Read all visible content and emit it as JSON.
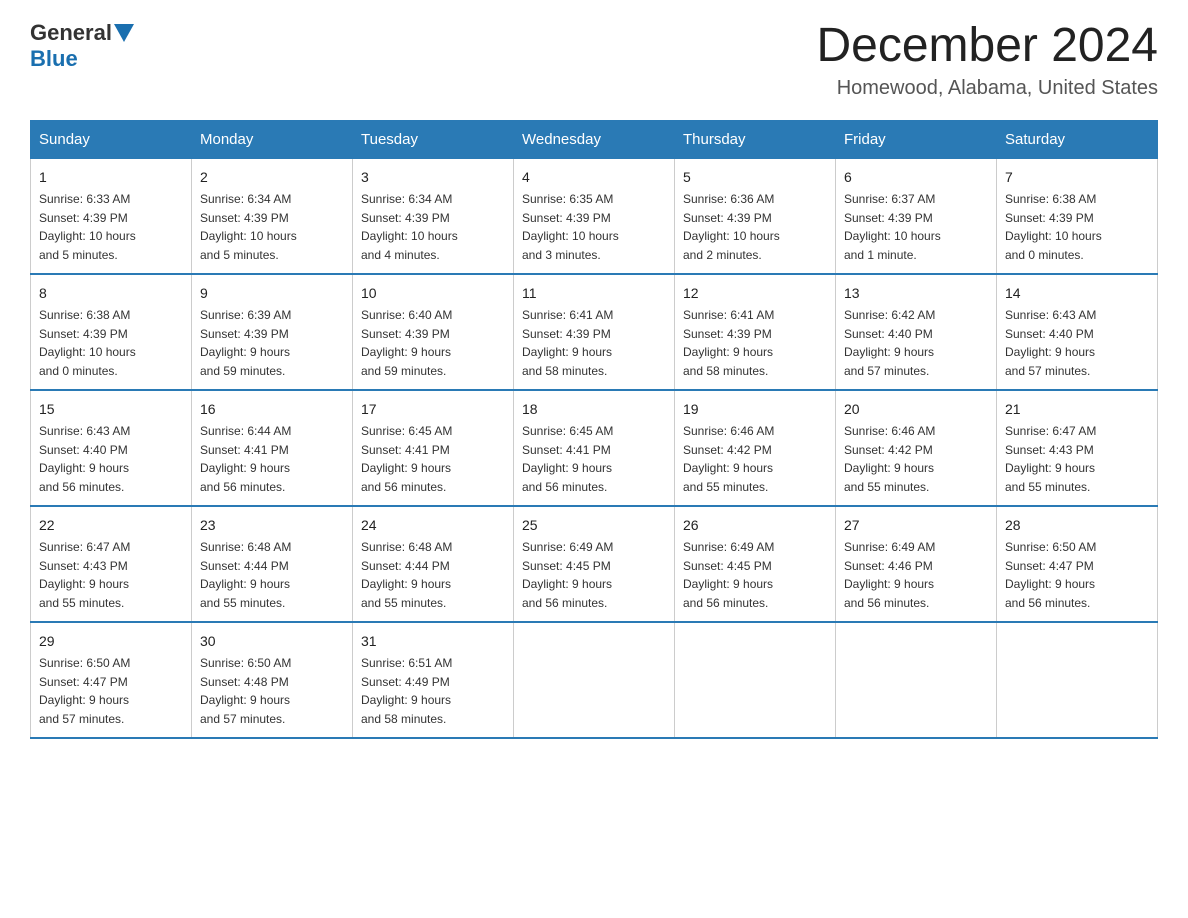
{
  "header": {
    "logo_general": "General",
    "logo_blue": "Blue",
    "month_title": "December 2024",
    "location": "Homewood, Alabama, United States"
  },
  "days_of_week": [
    "Sunday",
    "Monday",
    "Tuesday",
    "Wednesday",
    "Thursday",
    "Friday",
    "Saturday"
  ],
  "weeks": [
    [
      {
        "day": "1",
        "sunrise": "6:33 AM",
        "sunset": "4:39 PM",
        "daylight": "10 hours and 5 minutes."
      },
      {
        "day": "2",
        "sunrise": "6:34 AM",
        "sunset": "4:39 PM",
        "daylight": "10 hours and 5 minutes."
      },
      {
        "day": "3",
        "sunrise": "6:34 AM",
        "sunset": "4:39 PM",
        "daylight": "10 hours and 4 minutes."
      },
      {
        "day": "4",
        "sunrise": "6:35 AM",
        "sunset": "4:39 PM",
        "daylight": "10 hours and 3 minutes."
      },
      {
        "day": "5",
        "sunrise": "6:36 AM",
        "sunset": "4:39 PM",
        "daylight": "10 hours and 2 minutes."
      },
      {
        "day": "6",
        "sunrise": "6:37 AM",
        "sunset": "4:39 PM",
        "daylight": "10 hours and 1 minute."
      },
      {
        "day": "7",
        "sunrise": "6:38 AM",
        "sunset": "4:39 PM",
        "daylight": "10 hours and 0 minutes."
      }
    ],
    [
      {
        "day": "8",
        "sunrise": "6:38 AM",
        "sunset": "4:39 PM",
        "daylight": "10 hours and 0 minutes."
      },
      {
        "day": "9",
        "sunrise": "6:39 AM",
        "sunset": "4:39 PM",
        "daylight": "9 hours and 59 minutes."
      },
      {
        "day": "10",
        "sunrise": "6:40 AM",
        "sunset": "4:39 PM",
        "daylight": "9 hours and 59 minutes."
      },
      {
        "day": "11",
        "sunrise": "6:41 AM",
        "sunset": "4:39 PM",
        "daylight": "9 hours and 58 minutes."
      },
      {
        "day": "12",
        "sunrise": "6:41 AM",
        "sunset": "4:39 PM",
        "daylight": "9 hours and 58 minutes."
      },
      {
        "day": "13",
        "sunrise": "6:42 AM",
        "sunset": "4:40 PM",
        "daylight": "9 hours and 57 minutes."
      },
      {
        "day": "14",
        "sunrise": "6:43 AM",
        "sunset": "4:40 PM",
        "daylight": "9 hours and 57 minutes."
      }
    ],
    [
      {
        "day": "15",
        "sunrise": "6:43 AM",
        "sunset": "4:40 PM",
        "daylight": "9 hours and 56 minutes."
      },
      {
        "day": "16",
        "sunrise": "6:44 AM",
        "sunset": "4:41 PM",
        "daylight": "9 hours and 56 minutes."
      },
      {
        "day": "17",
        "sunrise": "6:45 AM",
        "sunset": "4:41 PM",
        "daylight": "9 hours and 56 minutes."
      },
      {
        "day": "18",
        "sunrise": "6:45 AM",
        "sunset": "4:41 PM",
        "daylight": "9 hours and 56 minutes."
      },
      {
        "day": "19",
        "sunrise": "6:46 AM",
        "sunset": "4:42 PM",
        "daylight": "9 hours and 55 minutes."
      },
      {
        "day": "20",
        "sunrise": "6:46 AM",
        "sunset": "4:42 PM",
        "daylight": "9 hours and 55 minutes."
      },
      {
        "day": "21",
        "sunrise": "6:47 AM",
        "sunset": "4:43 PM",
        "daylight": "9 hours and 55 minutes."
      }
    ],
    [
      {
        "day": "22",
        "sunrise": "6:47 AM",
        "sunset": "4:43 PM",
        "daylight": "9 hours and 55 minutes."
      },
      {
        "day": "23",
        "sunrise": "6:48 AM",
        "sunset": "4:44 PM",
        "daylight": "9 hours and 55 minutes."
      },
      {
        "day": "24",
        "sunrise": "6:48 AM",
        "sunset": "4:44 PM",
        "daylight": "9 hours and 55 minutes."
      },
      {
        "day": "25",
        "sunrise": "6:49 AM",
        "sunset": "4:45 PM",
        "daylight": "9 hours and 56 minutes."
      },
      {
        "day": "26",
        "sunrise": "6:49 AM",
        "sunset": "4:45 PM",
        "daylight": "9 hours and 56 minutes."
      },
      {
        "day": "27",
        "sunrise": "6:49 AM",
        "sunset": "4:46 PM",
        "daylight": "9 hours and 56 minutes."
      },
      {
        "day": "28",
        "sunrise": "6:50 AM",
        "sunset": "4:47 PM",
        "daylight": "9 hours and 56 minutes."
      }
    ],
    [
      {
        "day": "29",
        "sunrise": "6:50 AM",
        "sunset": "4:47 PM",
        "daylight": "9 hours and 57 minutes."
      },
      {
        "day": "30",
        "sunrise": "6:50 AM",
        "sunset": "4:48 PM",
        "daylight": "9 hours and 57 minutes."
      },
      {
        "day": "31",
        "sunrise": "6:51 AM",
        "sunset": "4:49 PM",
        "daylight": "9 hours and 58 minutes."
      },
      null,
      null,
      null,
      null
    ]
  ]
}
